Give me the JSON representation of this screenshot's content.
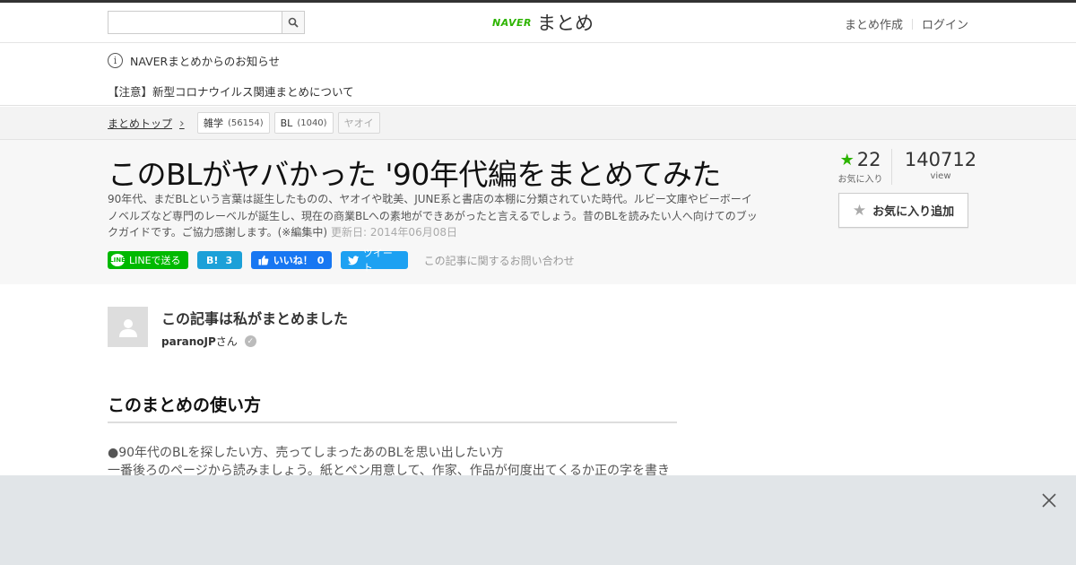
{
  "header": {
    "search_placeholder": "",
    "logo_brand": "NAVER",
    "logo_text": "まとめ",
    "links": [
      "まとめ作成",
      "ログイン"
    ]
  },
  "notice": {
    "title": "NAVERまとめからのお知らせ",
    "item": "【注意】新型コロナウイルス関連まとめについて"
  },
  "breadcrumb": {
    "top": "まとめトップ",
    "tags": [
      {
        "label": "雑学",
        "count": "(56154)"
      },
      {
        "label": "BL",
        "count": "(1040)"
      },
      {
        "label": "ヤオイ",
        "count": ""
      }
    ]
  },
  "article": {
    "title": "このBLがヤバかった '90年代編をまとめてみた",
    "description": "90年代、まだBLという言葉は誕生したものの、ヤオイや耽美、JUNE系と書店の本棚に分類されていた時代。ルビー文庫やビーボーイノベルズなど専門のレーベルが誕生し、現在の商業BLへの素地ができあがったと言えるでしょう。昔のBLを読みたい人へ向けてのブックガイドです。ご協力感謝します。(※編集中)",
    "updated": "更新日: 2014年06月08日",
    "share": {
      "line": "LINEで送る",
      "hatena_count": "3",
      "fb_label": "いいね！",
      "fb_count": "0",
      "tweet": "ツイート"
    },
    "inquiry": "この記事に関するお問い合わせ"
  },
  "stats": {
    "favorites": "22",
    "favorites_label": "お気に入り",
    "views": "140712",
    "views_label": "view",
    "fav_button": "お気に入り追加"
  },
  "author": {
    "heading": "この記事は私がまとめました",
    "name": "paranoJP",
    "suffix": "さん"
  },
  "section": {
    "heading": "このまとめの使い方",
    "lines": [
      "●90年代のBLを探したい方、売ってしまったあのBLを思い出したい方",
      "一番後ろのページから読みましょう。紙とペン用意して、作家、作品が何度出てくるか正の字を書き"
    ]
  },
  "colors": {
    "naver_green": "#2db400",
    "line_green": "#00b900",
    "hatena_blue": "#1ca0d8",
    "facebook_blue": "#1877f2",
    "twitter_blue": "#1da1f2",
    "overlay": "#e1e5e8"
  },
  "icons": [
    "search-icon",
    "info-icon",
    "chevron-right-icon",
    "star-icon",
    "avatar-icon",
    "verified-icon",
    "close-icon"
  ]
}
